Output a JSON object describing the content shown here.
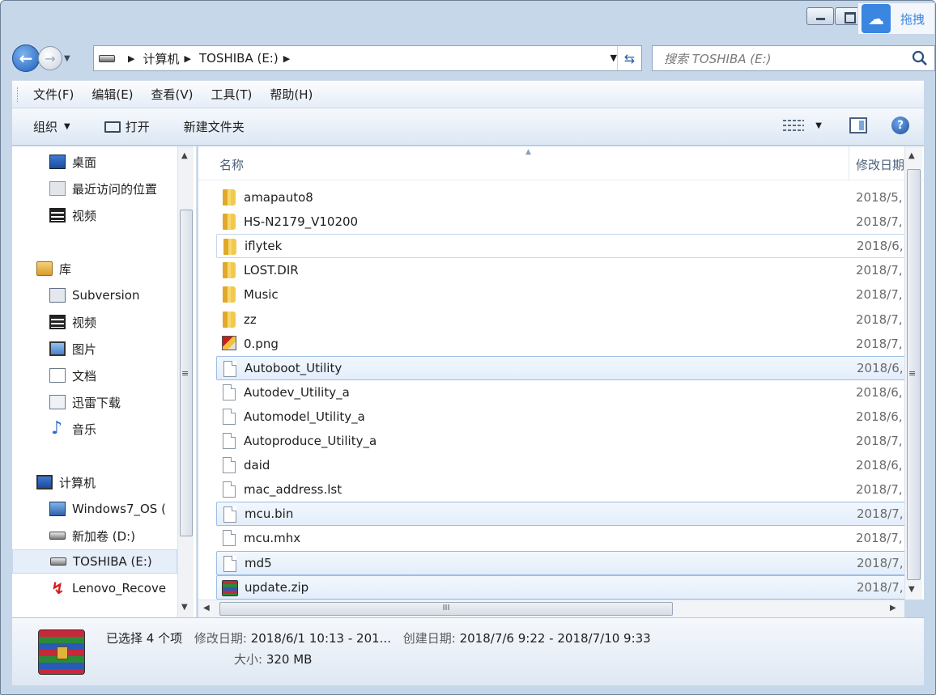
{
  "window": {
    "baidu_label": "拖拽"
  },
  "address": {
    "crumbs": [
      "计算机",
      "TOSHIBA (E:)"
    ],
    "search_placeholder": "搜索 TOSHIBA (E:)"
  },
  "menu": [
    "文件(F)",
    "编辑(E)",
    "查看(V)",
    "工具(T)",
    "帮助(H)"
  ],
  "toolbar": {
    "organize": "组织",
    "open": "打开",
    "new_folder": "新建文件夹"
  },
  "nav": {
    "items": [
      {
        "label": "桌面",
        "icon": "desktop-icon"
      },
      {
        "label": "最近访问的位置",
        "icon": "recent-places-icon"
      },
      {
        "label": "视频",
        "icon": "video-icon"
      },
      {
        "label": "库",
        "icon": "library-icon"
      },
      {
        "label": "Subversion",
        "icon": "subversion-icon"
      },
      {
        "label": "视频",
        "icon": "video-icon"
      },
      {
        "label": "图片",
        "icon": "pictures-icon"
      },
      {
        "label": "文档",
        "icon": "documents-icon"
      },
      {
        "label": "迅雷下载",
        "icon": "download-icon"
      },
      {
        "label": "音乐",
        "icon": "music-icon"
      },
      {
        "label": "计算机",
        "icon": "computer-icon"
      },
      {
        "label": "Windows7_OS (",
        "icon": "windows-drive-icon"
      },
      {
        "label": "新加卷 (D:)",
        "icon": "drive-icon"
      },
      {
        "label": "TOSHIBA (E:)",
        "icon": "drive-icon"
      },
      {
        "label": "Lenovo_Recove",
        "icon": "lenovo-recovery-icon"
      }
    ]
  },
  "files": {
    "columns": {
      "name": "名称",
      "date": "修改日期"
    },
    "rows": [
      {
        "name": "amapauto8",
        "date": "2018/5,",
        "type": "folder",
        "selected": false
      },
      {
        "name": "HS-N2179_V10200",
        "date": "2018/7,",
        "type": "folder",
        "selected": false
      },
      {
        "name": "iflytek",
        "date": "2018/6,",
        "type": "folder",
        "selected": false,
        "hover": true
      },
      {
        "name": "LOST.DIR",
        "date": "2018/7,",
        "type": "folder",
        "selected": false
      },
      {
        "name": "Music",
        "date": "2018/7,",
        "type": "folder",
        "selected": false
      },
      {
        "name": "zz",
        "date": "2018/7,",
        "type": "folder",
        "selected": false
      },
      {
        "name": "0.png",
        "date": "2018/7,",
        "type": "png",
        "selected": false
      },
      {
        "name": "Autoboot_Utility",
        "date": "2018/6,",
        "type": "file",
        "selected": true
      },
      {
        "name": "Autodev_Utility_a",
        "date": "2018/6,",
        "type": "file",
        "selected": false
      },
      {
        "name": "Automodel_Utility_a",
        "date": "2018/6,",
        "type": "file",
        "selected": false
      },
      {
        "name": "Autoproduce_Utility_a",
        "date": "2018/7,",
        "type": "file",
        "selected": false
      },
      {
        "name": "daid",
        "date": "2018/6,",
        "type": "file",
        "selected": false
      },
      {
        "name": "mac_address.lst",
        "date": "2018/7,",
        "type": "file",
        "selected": false
      },
      {
        "name": "mcu.bin",
        "date": "2018/7,",
        "type": "file",
        "selected": true
      },
      {
        "name": "mcu.mhx",
        "date": "2018/7,",
        "type": "file",
        "selected": false
      },
      {
        "name": "md5",
        "date": "2018/7,",
        "type": "file",
        "selected": true
      },
      {
        "name": "update.zip",
        "date": "2018/7,",
        "type": "zip",
        "selected": true
      }
    ]
  },
  "hscroll_label": "III",
  "details": {
    "count": "已选择 4 个项",
    "modified_label": "修改日期:",
    "modified_value": "2018/6/1 10:13 - 201...",
    "created_label": "创建日期:",
    "created_value": "2018/7/6 9:22 - 2018/7/10 9:33",
    "size_label": "大小:",
    "size_value": "320 MB"
  }
}
